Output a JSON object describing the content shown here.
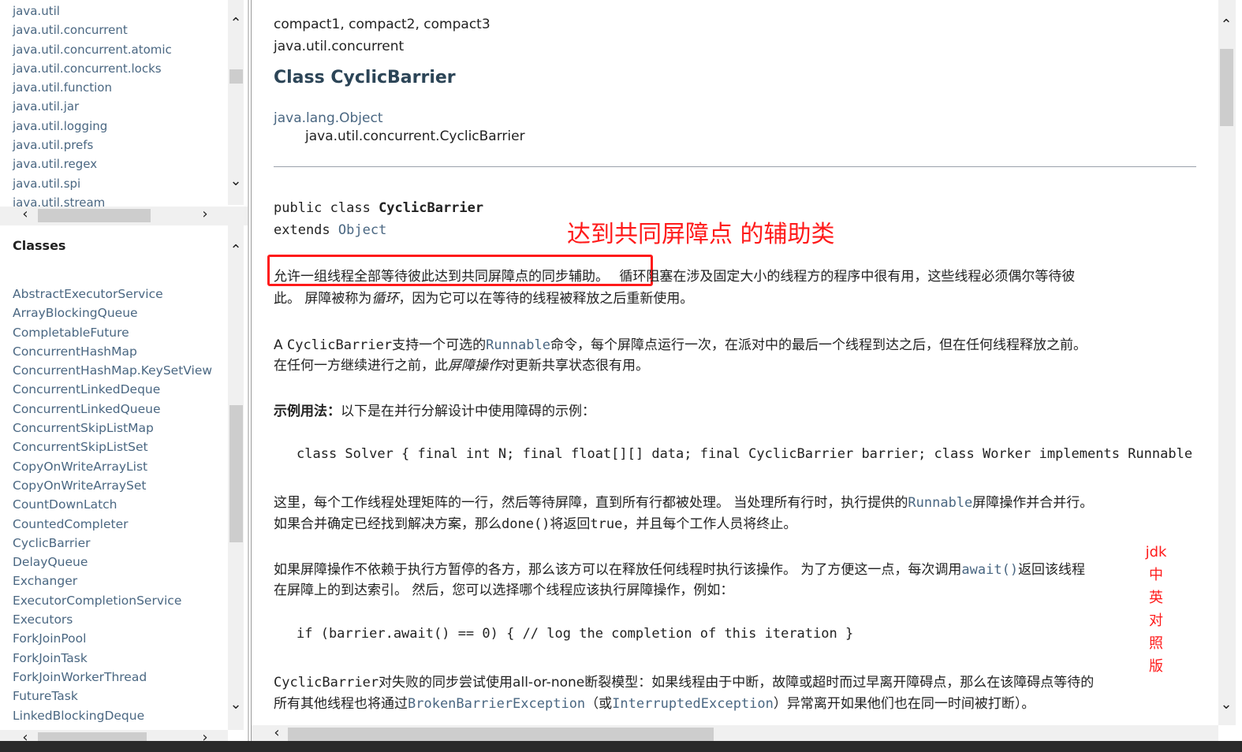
{
  "packages_frame": {
    "items": [
      "java.util",
      "java.util.concurrent",
      "java.util.concurrent.atomic",
      "java.util.concurrent.locks",
      "java.util.function",
      "java.util.jar",
      "java.util.logging",
      "java.util.prefs",
      "java.util.regex",
      "java.util.spi",
      "java.util.stream"
    ]
  },
  "classes_frame": {
    "heading": "Classes",
    "items": [
      "AbstractExecutorService",
      "ArrayBlockingQueue",
      "CompletableFuture",
      "ConcurrentHashMap",
      "ConcurrentHashMap.KeySetView",
      "ConcurrentLinkedDeque",
      "ConcurrentLinkedQueue",
      "ConcurrentSkipListMap",
      "ConcurrentSkipListSet",
      "CopyOnWriteArrayList",
      "CopyOnWriteArraySet",
      "CountDownLatch",
      "CountedCompleter",
      "CyclicBarrier",
      "DelayQueue",
      "Exchanger",
      "ExecutorCompletionService",
      "Executors",
      "ForkJoinPool",
      "ForkJoinTask",
      "ForkJoinWorkerThread",
      "FutureTask",
      "LinkedBlockingDeque"
    ]
  },
  "main": {
    "profiles": "compact1, compact2, compact3",
    "package": "java.util.concurrent",
    "class_title": "Class CyclicBarrier",
    "inheritance_parent": "java.lang.Object",
    "inheritance_child": "java.util.concurrent.CyclicBarrier",
    "signature_line1_kw": "public class ",
    "signature_line1_name": "CyclicBarrier",
    "signature_line2_kw": "extends ",
    "signature_line2_link": "Object",
    "p1_boxed": "允许一组线程全部等待彼此达到共同屏障点的同步辅助。",
    "p1_rest": "循环阻塞在涉及固定大小的线程方的程序中很有用，这些线程必须偶尔等待彼",
    "p1_line2a": "此。 屏障被称为",
    "p1_line2_em": "循环",
    "p1_line2b": "，因为它可以在等待的线程被释放之后重新使用。",
    "p2_prefix": "A ",
    "p2_code": "CyclicBarrier",
    "p2_mid": "支持一个可选的",
    "p2_code2": "Runnable",
    "p2_rest": "命令，每个屏障点运行一次，在派对中的最后一个线程到达之后，但在任何线程释放之前。",
    "p2_line2a": "在任何一方继续进行之前，此",
    "p2_line2_em": "屏障操作",
    "p2_line2b": "对更新共享状态很有用。",
    "p3_bold": "示例用法：",
    "p3_rest": "以下是在并行分解设计中使用障碍的示例：",
    "code1": "class Solver { final int N; final float[][] data; final CyclicBarrier barrier; class Worker implements Runnable",
    "p4_a": "这里，每个工作线程处理矩阵的一行，然后等待屏障，直到所有行都被处理。 当处理所有行时，执行提供的",
    "p4_code": "Runnable",
    "p4_b": "屏障操作并合并行。",
    "p4_line2a": "如果合并确定已经找到解决方案，那么",
    "p4_line2_code": "done()",
    "p4_line2b": "将返回",
    "p4_line2_code2": "true",
    "p4_line2c": "，并且每个工作人员将终止。",
    "p5_a": "如果屏障操作不依赖于执行方暂停的各方，那么该方可以在释放任何线程时执行该操作。 为了方便这一点，每次调用",
    "p5_code": "await()",
    "p5_b": "返回该线程",
    "p5_line2": "在屏障上的到达索引。 然后，您可以选择哪个线程应该执行屏障操作，例如：",
    "code2": "if (barrier.await() == 0) { // log the completion of this iteration }",
    "p6_code": "CyclicBarrier",
    "p6_a": "对失败的同步尝试使用all-or-none断裂模型：如果线程由于中断，故障或超时而过早离开障碍点，那么在该障碍点等待的",
    "p6_line2a": "所有其他线程也将通过",
    "p6_line2_code": "BrokenBarrierException",
    "p6_line2b": "（或",
    "p6_line2_code2": "InterruptedException",
    "p6_line2c": "）异常离开如果他们也在同一时间被打断）。"
  },
  "annotations": {
    "heading": "达到共同屏障点 的辅助类",
    "side_label_line1": "jdk",
    "side_label_chars": [
      "中",
      "英",
      "对",
      "照",
      "版"
    ]
  }
}
